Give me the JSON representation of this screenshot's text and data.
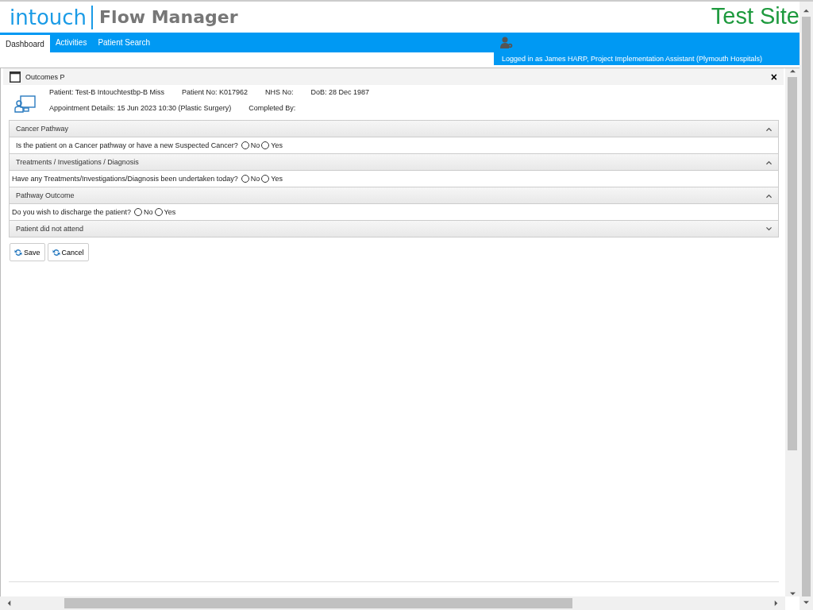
{
  "logo": {
    "brand": "intouch",
    "product": "Flow Manager"
  },
  "site_label": "Test Site",
  "nav": {
    "tabs": [
      {
        "label": "Dashboard",
        "selected": true
      },
      {
        "label": "Activities",
        "selected": false
      },
      {
        "label": "Patient Search",
        "selected": false
      }
    ],
    "login": "Logged in as James HARP, Project Implementation Assistant (Plymouth Hospitals)"
  },
  "dialog": {
    "title": "Outcomes P",
    "close": "×",
    "patient_info": [
      [
        {
          "label": "Patient:",
          "value": "Test-B Intouchtestbp-B Miss"
        },
        {
          "label": "Patient No:",
          "value": "K017962"
        },
        {
          "label": "NHS No:"
        },
        {
          "label": "DoB:",
          "value": "28 Dec 1987"
        }
      ],
      [
        {
          "label": "Appointment Details:",
          "value": "15 Jun 2023 10:30 (Plastic Surgery)"
        },
        {
          "label": "Completed By:"
        }
      ]
    ],
    "sections": [
      {
        "title": "Cancer Pathway",
        "expanded": true,
        "question": "Is the patient on a Cancer pathway or have a new Suspected Cancer?",
        "indented": true,
        "options": [
          {
            "label": "No",
            "selected": false
          },
          {
            "label": "Yes",
            "selected": false
          }
        ]
      },
      {
        "title": "Treatments / Investigations / Diagnosis",
        "expanded": true,
        "question": "Have any Treatments/Investigations/Diagnosis been undertaken today?",
        "indented": false,
        "options": [
          {
            "label": "No",
            "selected": false
          },
          {
            "label": "Yes",
            "selected": false
          }
        ]
      },
      {
        "title": "Pathway Outcome",
        "expanded": true,
        "question": "Do you wish to discharge the patient?",
        "indented": false,
        "options": [
          {
            "label": "No",
            "selected": false
          },
          {
            "label": "Yes",
            "selected": false
          }
        ]
      },
      {
        "title": "Patient did not attend",
        "expanded": false
      }
    ],
    "buttons": [
      "Save",
      "Cancel"
    ]
  }
}
